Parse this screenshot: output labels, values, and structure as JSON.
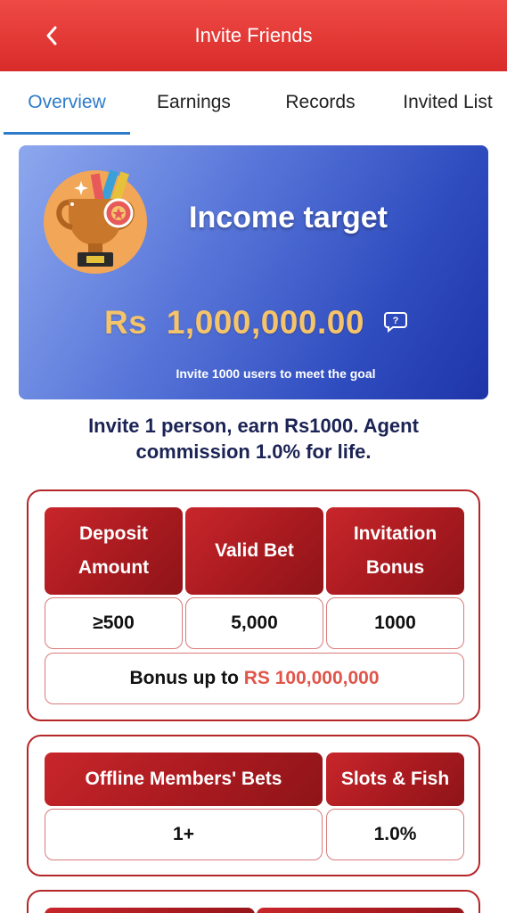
{
  "header": {
    "title": "Invite Friends",
    "back_icon": "chevron-left-icon"
  },
  "tabs": [
    {
      "label": "Overview",
      "active": true
    },
    {
      "label": "Earnings",
      "active": false
    },
    {
      "label": "Records",
      "active": false
    },
    {
      "label": "Invited List",
      "active": false
    }
  ],
  "income": {
    "title": "Income target",
    "amount": "Rs  1,000,000.00",
    "help_icon": "question-bubble-icon",
    "subtitle": "Invite 1000 users to meet the goal",
    "trophy_icon": "trophy-icon"
  },
  "headline": {
    "line1": "Invite 1 person, earn Rs1000. Agent",
    "line2": "commission 1.0% for life."
  },
  "invite_table": {
    "headers": [
      {
        "line1": "Deposit",
        "line2": "Amount"
      },
      {
        "line1": "Valid Bet",
        "line2": ""
      },
      {
        "line1": "Invitation",
        "line2": "Bonus"
      }
    ],
    "values": [
      "≥500",
      "5,000",
      "1000"
    ],
    "bonus_prefix": "Bonus up to ",
    "bonus_amount": "RS 100,000,000"
  },
  "commission_table": {
    "headers": [
      "Offline Members' Bets",
      "Slots & Fish"
    ],
    "values": [
      "1+",
      "1.0%"
    ]
  },
  "colors": {
    "topbar": "#e63b37",
    "active_tab": "#2d7bc8",
    "card_dark": "#1e35a8",
    "amount": "#f5c46a",
    "section_border": "#b52628",
    "bonus_red": "#e0554a"
  }
}
